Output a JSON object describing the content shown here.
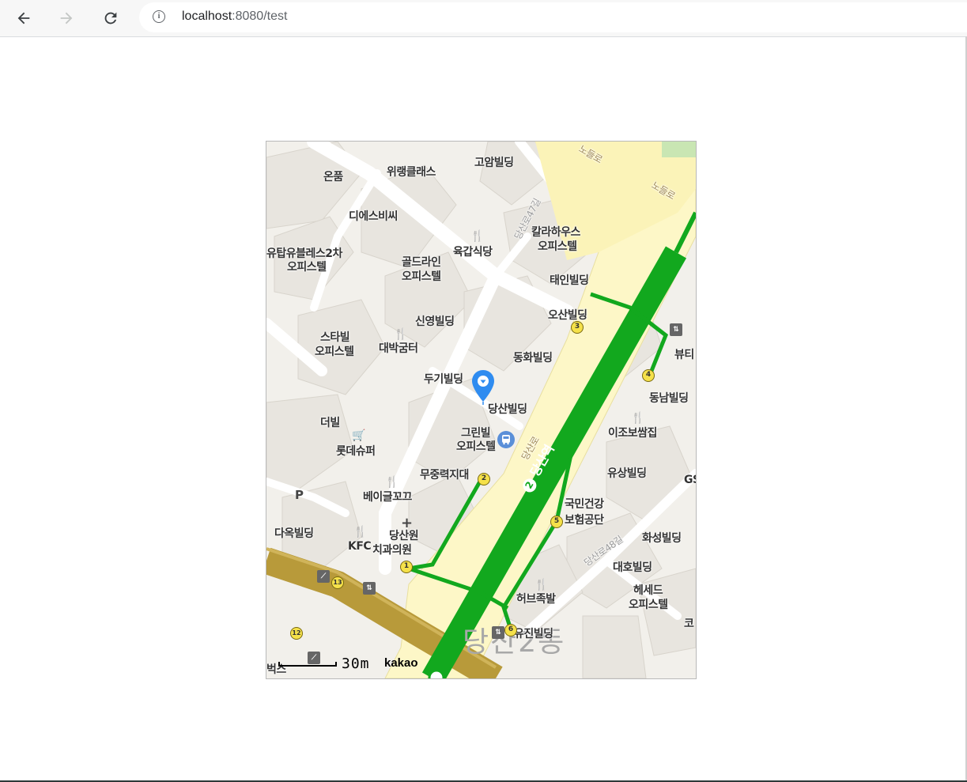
{
  "browser": {
    "url_host": "localhost",
    "url_path": ":8080/test"
  },
  "map": {
    "provider": "kakao",
    "scale_label": "30m",
    "district_label": "당산2동",
    "subway_station": "당산역",
    "subway_line_number": "2",
    "colors": {
      "subway_line": "#12a81e",
      "main_road": "#fdf7c7",
      "rail": "#b89a3a",
      "marker": "#2f8cf0"
    },
    "roads": [
      "노들로",
      "노들로",
      "당산로47길",
      "당산로",
      "당산로48길"
    ],
    "places": [
      "온품",
      "위랭클래스",
      "고암빌딩",
      "디에스비씨",
      "유탑유블레스2차",
      "오피스텔",
      "칼라하우스",
      "오피스텔",
      "육갑식당",
      "골드라인",
      "오피스텔",
      "태인빌딩",
      "오산빌딩",
      "신영빌딩",
      "스타빌",
      "오피스텔",
      "대박굼터",
      "동화빌딩",
      "뷰티",
      "두기빌딩",
      "당산빌딩",
      "동남빌딩",
      "더빌",
      "롯데슈퍼",
      "그린빌",
      "오피스텔",
      "이조보쌈집",
      "무중력지대",
      "유상빌딩",
      "GS",
      "베이글꼬끄",
      "국민건강",
      "보험공단",
      "다옥빌딩",
      "KFC",
      "당산원",
      "치과의원",
      "화성빌딩",
      "대호빌딩",
      "허브족발",
      "헤세드",
      "오피스텔",
      "코",
      "유진빌딩",
      "벅스"
    ],
    "exits": [
      "1",
      "2",
      "3",
      "4",
      "5",
      "6",
      "12",
      "13"
    ],
    "icons": [
      "restaurant-icon",
      "shopping-cart-icon",
      "hospital-cross-icon",
      "parking-icon",
      "bus-stop-icon",
      "escalator-icon",
      "elevator-icon",
      "location-pin-icon"
    ]
  }
}
